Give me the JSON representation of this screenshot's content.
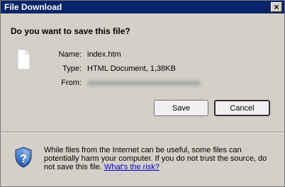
{
  "window": {
    "title": "File Download",
    "close_glyph": "×"
  },
  "prompt": {
    "question": "Do you want to save this file?"
  },
  "file": {
    "icon": "document-icon",
    "name_label": "Name:",
    "name_value": "index.htm",
    "type_label": "Type:",
    "type_value": "HTML Document, 1,38KB",
    "from_label": "From:"
  },
  "buttons": {
    "save": "Save",
    "cancel": "Cancel"
  },
  "warning": {
    "icon": "security-shield-icon",
    "text": "While files from the Internet can be useful, some files can potentially harm your computer. If you do not trust the source, do not save this file. ",
    "link": "What's the risk?"
  }
}
